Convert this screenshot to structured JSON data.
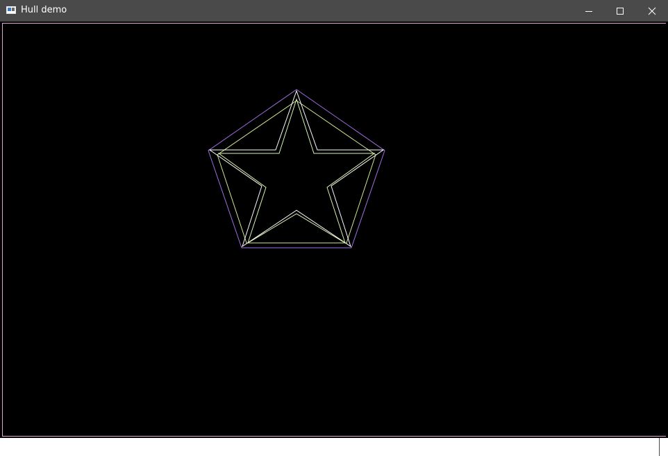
{
  "window": {
    "title": "Hull demo",
    "icon": "app-window-icon",
    "controls": [
      {
        "name": "minimize-icon"
      },
      {
        "name": "maximize-icon"
      },
      {
        "name": "close-icon"
      }
    ]
  },
  "canvas": {
    "background": "#000000",
    "frame_color": "#e6a6d6",
    "shapes": [
      {
        "name": "outer-star-outline",
        "color": "#ffffff"
      },
      {
        "name": "inner-star-outline",
        "color": "#d8f5b0"
      },
      {
        "name": "outer-convex-hull",
        "color": "#a06fe0"
      },
      {
        "name": "inner-convex-hull",
        "color": "#cfe890"
      }
    ]
  }
}
